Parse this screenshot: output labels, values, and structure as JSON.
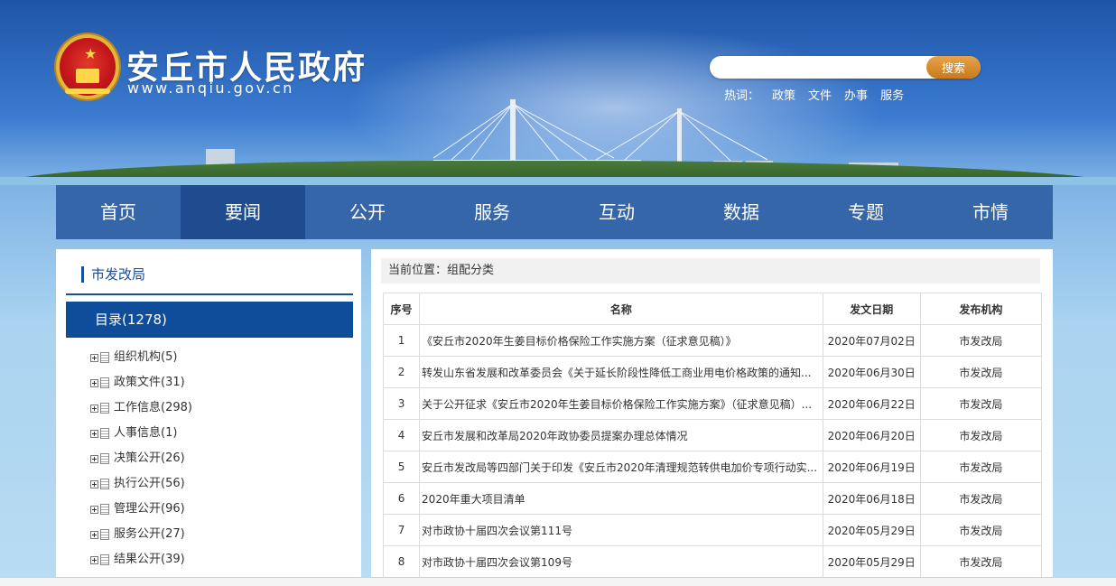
{
  "header": {
    "title": "安丘市人民政府",
    "url": "www.anqiu.gov.cn",
    "search": {
      "placeholder": "",
      "button": "搜索"
    },
    "hot_label": "热词：",
    "hot_words": [
      "政策",
      "文件",
      "办事",
      "服务"
    ]
  },
  "nav": [
    "首页",
    "要闻",
    "公开",
    "服务",
    "互动",
    "数据",
    "专题",
    "市情"
  ],
  "nav_active": "要闻",
  "sidebar": {
    "heading": "市发改局",
    "category": "目录(1278)",
    "items": [
      "组织机构(5)",
      "政策文件(31)",
      "工作信息(298)",
      "人事信息(1)",
      "决策公开(26)",
      "执行公开(56)",
      "管理公开(96)",
      "服务公开(27)",
      "结果公开(39)"
    ]
  },
  "main": {
    "breadcrumb": "当前位置：组配分类",
    "columns": [
      "序号",
      "名称",
      "发文日期",
      "发布机构"
    ],
    "rows": [
      [
        "1",
        "《安丘市2020年生姜目标价格保险工作实施方案（征求意见稿）》",
        "2020年07月02日",
        "市发改局"
      ],
      [
        "2",
        "转发山东省发展和改革委员会《关于延长阶段性降低工商业用电价格政策的通知...",
        "2020年06月30日",
        "市发改局"
      ],
      [
        "3",
        "关于公开征求《安丘市2020年生姜目标价格保险工作实施方案》（征求意见稿）...",
        "2020年06月22日",
        "市发改局"
      ],
      [
        "4",
        "安丘市发展和改革局2020年政协委员提案办理总体情况",
        "2020年06月20日",
        "市发改局"
      ],
      [
        "5",
        "安丘市发改局等四部门关于印发《安丘市2020年清理规范转供电加价专项行动实...",
        "2020年06月19日",
        "市发改局"
      ],
      [
        "6",
        "2020年重大项目清单",
        "2020年06月18日",
        "市发改局"
      ],
      [
        "7",
        "对市政协十届四次会议第111号",
        "2020年05月29日",
        "市发改局"
      ],
      [
        "8",
        "对市政协十届四次会议第109号",
        "2020年05月29日",
        "市发改局"
      ]
    ]
  }
}
